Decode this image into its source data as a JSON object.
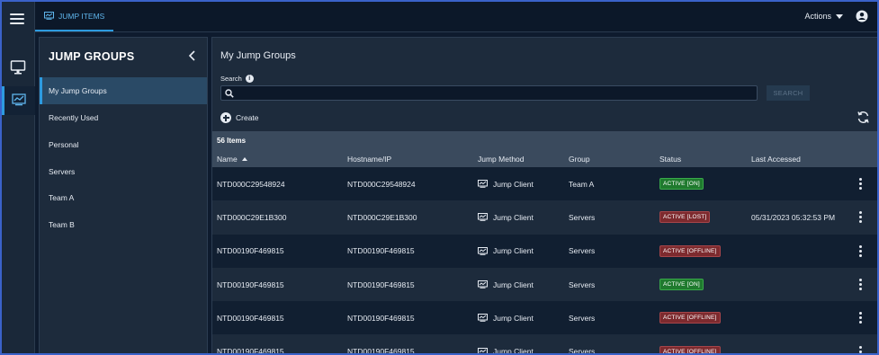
{
  "topbar": {
    "tab_label": "JUMP ITEMS",
    "actions_label": "Actions"
  },
  "rail": {
    "icons": [
      "menu-icon",
      "monitor-icon",
      "jump-items-icon"
    ]
  },
  "groups": {
    "title": "JUMP GROUPS",
    "items": [
      {
        "label": "My Jump Groups",
        "selected": true
      },
      {
        "label": "Recently Used"
      },
      {
        "label": "Personal"
      },
      {
        "label": "Servers"
      },
      {
        "label": "Team A"
      },
      {
        "label": "Team B"
      }
    ]
  },
  "main": {
    "title": "My Jump Groups",
    "search_label": "Search",
    "search_value": "",
    "search_button": "SEARCH",
    "create_label": "Create",
    "count_label": "56 Items",
    "columns": [
      "Name",
      "Hostname/IP",
      "Jump Method",
      "Group",
      "Status",
      "Last Accessed"
    ],
    "rows": [
      {
        "name": "NTD000C29548924",
        "host": "NTD000C29548924",
        "method": "Jump Client",
        "group": "Team A",
        "status": "ACTIVE [ON]",
        "status_kind": "on",
        "last": ""
      },
      {
        "name": "NTD000C29E1B300",
        "host": "NTD000C29E1B300",
        "method": "Jump Client",
        "group": "Servers",
        "status": "ACTIVE [LOST]",
        "status_kind": "lost",
        "last": "05/31/2023 05:32:53 PM"
      },
      {
        "name": "NTD00190F469815",
        "host": "NTD00190F469815",
        "method": "Jump Client",
        "group": "Servers",
        "status": "ACTIVE [OFFLINE]",
        "status_kind": "offline",
        "last": ""
      },
      {
        "name": "NTD00190F469815",
        "host": "NTD00190F469815",
        "method": "Jump Client",
        "group": "Servers",
        "status": "ACTIVE [ON]",
        "status_kind": "on",
        "last": ""
      },
      {
        "name": "NTD00190F469815",
        "host": "NTD00190F469815",
        "method": "Jump Client",
        "group": "Servers",
        "status": "ACTIVE [OFFLINE]",
        "status_kind": "offline",
        "last": ""
      },
      {
        "name": "NTD00190F469815",
        "host": "NTD00190F469815",
        "method": "Jump Client",
        "group": "Servers",
        "status": "ACTIVE [OFFLINE]",
        "status_kind": "offline",
        "last": ""
      }
    ]
  },
  "colors": {
    "accent": "#2d9be0",
    "status_on": "#1f7a2e",
    "status_off": "#7d2a2e",
    "background": "#0e1b2e"
  }
}
